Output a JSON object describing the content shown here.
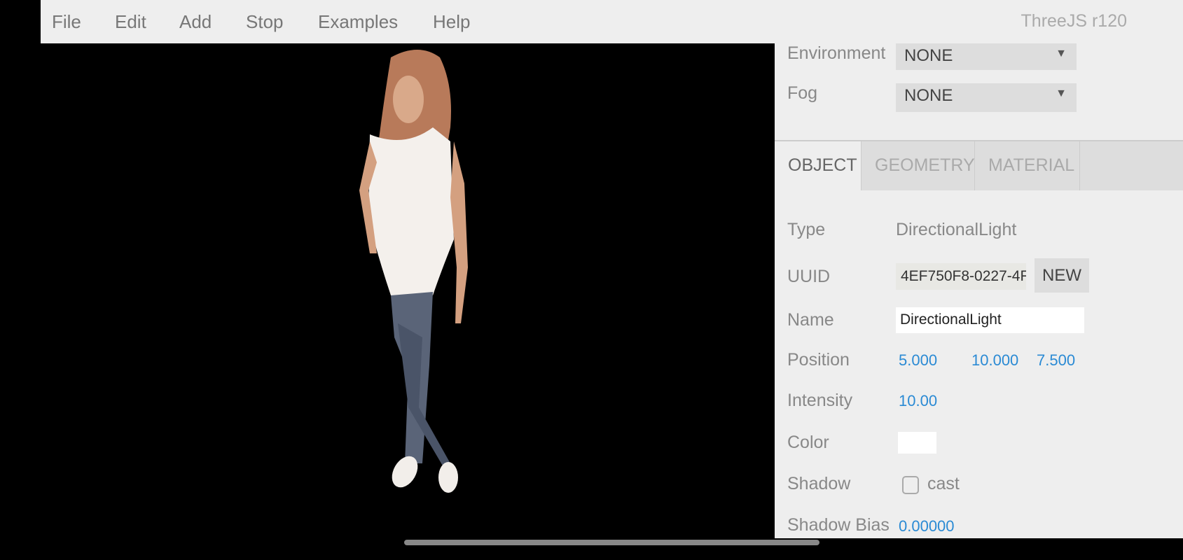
{
  "menu": {
    "items": [
      "File",
      "Edit",
      "Add",
      "Stop",
      "Examples",
      "Help"
    ],
    "version": "ThreeJS r120"
  },
  "scene": {
    "environment_label": "Environment",
    "environment_value": "NONE",
    "fog_label": "Fog",
    "fog_value": "NONE"
  },
  "tabs": [
    "OBJECT",
    "GEOMETRY",
    "MATERIAL"
  ],
  "object": {
    "type_label": "Type",
    "type_value": "DirectionalLight",
    "uuid_label": "UUID",
    "uuid_value": "4EF750F8-0227-4F",
    "new_label": "NEW",
    "name_label": "Name",
    "name_value": "DirectionalLight",
    "position_label": "Position",
    "position": [
      "5.000",
      "10.000",
      "7.500"
    ],
    "intensity_label": "Intensity",
    "intensity": "10.00",
    "color_label": "Color",
    "color": "#ffffff",
    "shadow_label": "Shadow",
    "shadow_cast_label": "cast",
    "shadow_cast": false,
    "shadow_bias_label": "Shadow Bias",
    "shadow_bias": "0.00000"
  }
}
